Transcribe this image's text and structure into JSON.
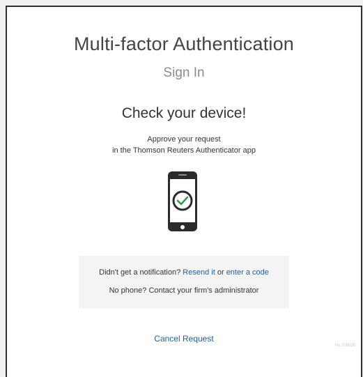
{
  "header": {
    "title": "Multi-factor Authentication",
    "subtitle": "Sign In"
  },
  "main": {
    "heading": "Check your device!",
    "instruction_line1": "Approve your request",
    "instruction_line2": "in the Thomson Reuters Authenticator app",
    "device_icon": "phone-check-icon"
  },
  "notice": {
    "prefix": "Didn't get a notification?",
    "resend_link": "Resend it",
    "or_text": "or",
    "enter_code_link": "enter a code",
    "no_phone": "No phone? Contact your firm's administrator"
  },
  "footer": {
    "cancel_label": "Cancel Request",
    "build_id": "Ho 208028"
  },
  "colors": {
    "link": "#1f5f9f",
    "check": "#2e9b4a",
    "phone_body": "#2b2b2b"
  }
}
